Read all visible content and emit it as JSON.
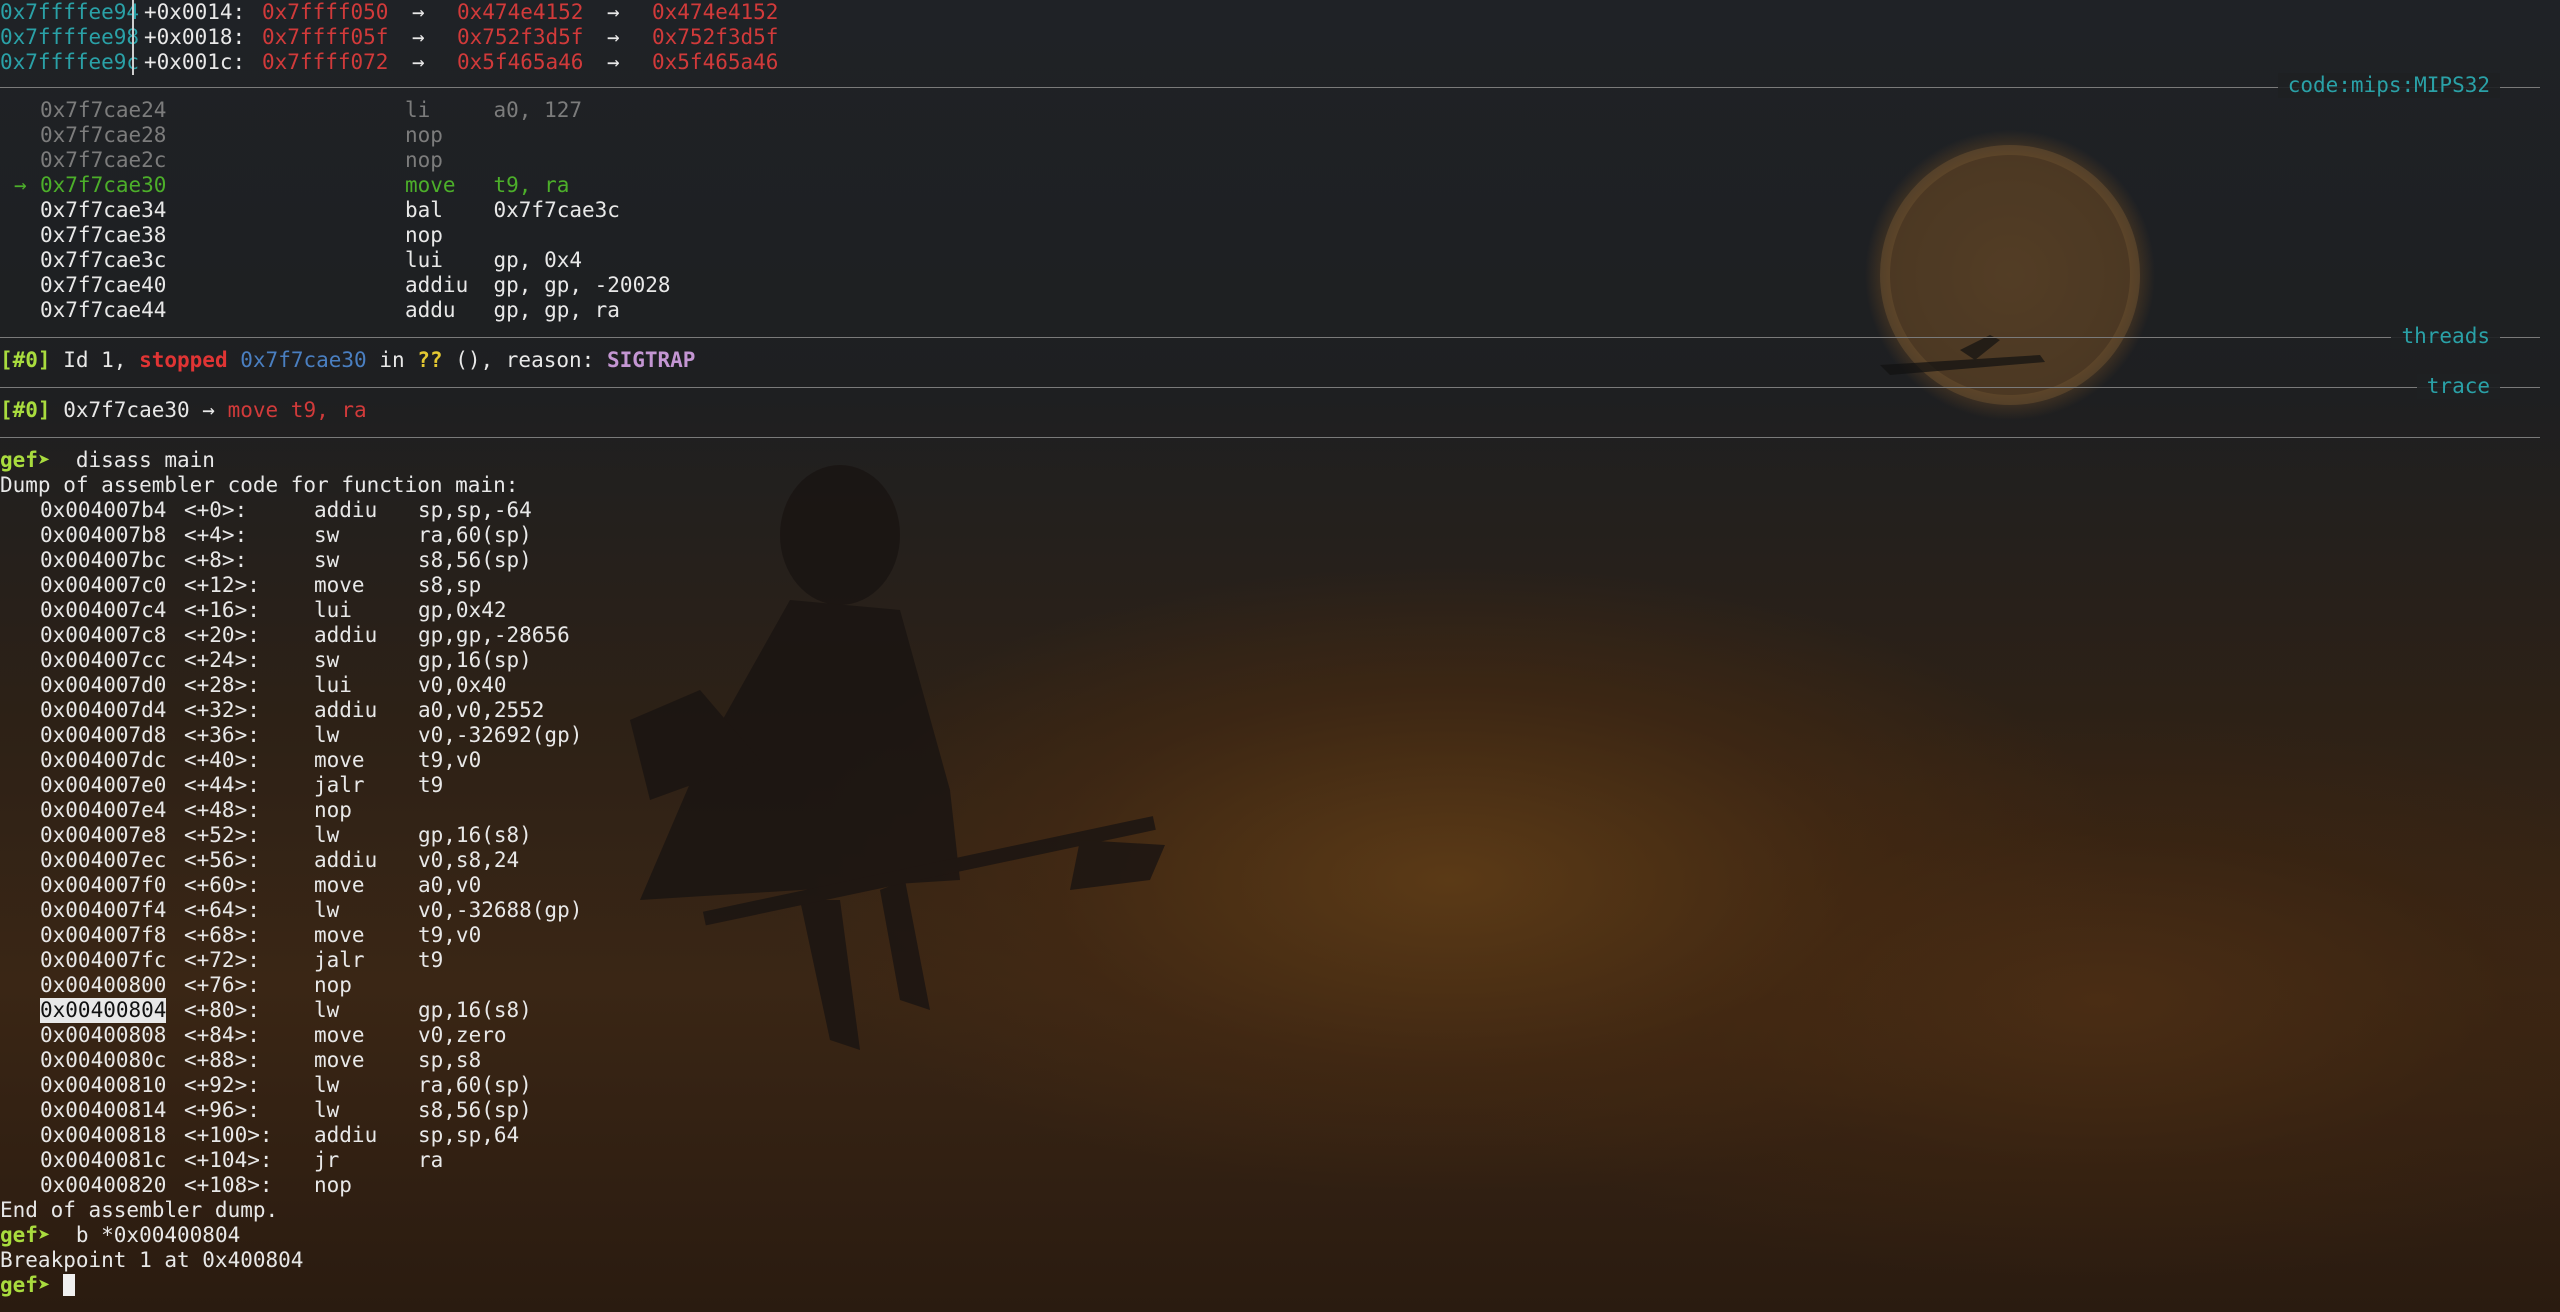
{
  "stack": [
    {
      "addr": "0x7ffffee94",
      "off": "+0x0014:",
      "v1": "0x7ffff050",
      "a1": "→",
      "v2": "0x474e4152",
      "a2": "→",
      "v3": "0x474e4152"
    },
    {
      "addr": "0x7ffffee98",
      "off": "+0x0018:",
      "v1": "0x7ffff05f",
      "a1": "→",
      "v2": "0x752f3d5f",
      "a2": "→",
      "v3": "0x752f3d5f"
    },
    {
      "addr": "0x7ffffee9c",
      "off": "+0x001c:",
      "v1": "0x7ffff072",
      "a1": "→",
      "v2": "0x5f465a46",
      "a2": "→",
      "v3": "0x5f465a46"
    }
  ],
  "sections": {
    "code_label": "code:mips:MIPS32",
    "threads_label": "threads",
    "trace_label": "trace"
  },
  "code": [
    {
      "prefix": "  ",
      "addr": "0x7f7cae24",
      "instr": "li     a0, 127",
      "state": "past"
    },
    {
      "prefix": "  ",
      "addr": "0x7f7cae28",
      "instr": "nop",
      "state": "past"
    },
    {
      "prefix": "  ",
      "addr": "0x7f7cae2c",
      "instr": "nop",
      "state": "past"
    },
    {
      "prefix": "→ ",
      "addr": "0x7f7cae30",
      "instr": "move   t9, ra",
      "state": "current"
    },
    {
      "prefix": "  ",
      "addr": "0x7f7cae34",
      "instr": "bal    0x7f7cae3c",
      "state": "next"
    },
    {
      "prefix": "  ",
      "addr": "0x7f7cae38",
      "instr": "nop",
      "state": "next"
    },
    {
      "prefix": "  ",
      "addr": "0x7f7cae3c",
      "instr": "lui    gp, 0x4",
      "state": "next"
    },
    {
      "prefix": "  ",
      "addr": "0x7f7cae40",
      "instr": "addiu  gp, gp, -20028",
      "state": "next"
    },
    {
      "prefix": "  ",
      "addr": "0x7f7cae44",
      "instr": "addu   gp, gp, ra",
      "state": "next"
    }
  ],
  "threads": {
    "idx": "[#0]",
    "text1": " Id 1, ",
    "stopped": "stopped",
    "sp1": " ",
    "addr": "0x7f7cae30",
    "in": " in ",
    "qq": "??",
    "text2": " (), reason: ",
    "reason": "SIGTRAP"
  },
  "trace": {
    "idx": "[#0]",
    "addr_arrow": " 0x7f7cae30 → ",
    "instr": "move t9, ra"
  },
  "session": {
    "prompt": "gef➤",
    "cmd1": "  disass main",
    "dump_header": "Dump of assembler code for function main:",
    "dump_footer": "End of assembler dump.",
    "cmd2": "  b *0x00400804",
    "bp_msg": "Breakpoint 1 at 0x400804"
  },
  "disasm": [
    {
      "addr": "0x004007b4",
      "off": "<+0>:",
      "op": "addiu",
      "args": "sp,sp,-64"
    },
    {
      "addr": "0x004007b8",
      "off": "<+4>:",
      "op": "sw",
      "args": "ra,60(sp)"
    },
    {
      "addr": "0x004007bc",
      "off": "<+8>:",
      "op": "sw",
      "args": "s8,56(sp)"
    },
    {
      "addr": "0x004007c0",
      "off": "<+12>:",
      "op": "move",
      "args": "s8,sp"
    },
    {
      "addr": "0x004007c4",
      "off": "<+16>:",
      "op": "lui",
      "args": "gp,0x42"
    },
    {
      "addr": "0x004007c8",
      "off": "<+20>:",
      "op": "addiu",
      "args": "gp,gp,-28656"
    },
    {
      "addr": "0x004007cc",
      "off": "<+24>:",
      "op": "sw",
      "args": "gp,16(sp)"
    },
    {
      "addr": "0x004007d0",
      "off": "<+28>:",
      "op": "lui",
      "args": "v0,0x40"
    },
    {
      "addr": "0x004007d4",
      "off": "<+32>:",
      "op": "addiu",
      "args": "a0,v0,2552"
    },
    {
      "addr": "0x004007d8",
      "off": "<+36>:",
      "op": "lw",
      "args": "v0,-32692(gp)"
    },
    {
      "addr": "0x004007dc",
      "off": "<+40>:",
      "op": "move",
      "args": "t9,v0"
    },
    {
      "addr": "0x004007e0",
      "off": "<+44>:",
      "op": "jalr",
      "args": "t9"
    },
    {
      "addr": "0x004007e4",
      "off": "<+48>:",
      "op": "nop",
      "args": ""
    },
    {
      "addr": "0x004007e8",
      "off": "<+52>:",
      "op": "lw",
      "args": "gp,16(s8)"
    },
    {
      "addr": "0x004007ec",
      "off": "<+56>:",
      "op": "addiu",
      "args": "v0,s8,24"
    },
    {
      "addr": "0x004007f0",
      "off": "<+60>:",
      "op": "move",
      "args": "a0,v0"
    },
    {
      "addr": "0x004007f4",
      "off": "<+64>:",
      "op": "lw",
      "args": "v0,-32688(gp)"
    },
    {
      "addr": "0x004007f8",
      "off": "<+68>:",
      "op": "move",
      "args": "t9,v0"
    },
    {
      "addr": "0x004007fc",
      "off": "<+72>:",
      "op": "jalr",
      "args": "t9"
    },
    {
      "addr": "0x00400800",
      "off": "<+76>:",
      "op": "nop",
      "args": ""
    },
    {
      "addr": "0x00400804",
      "off": "<+80>:",
      "op": "lw",
      "args": "gp,16(s8)",
      "selected": true
    },
    {
      "addr": "0x00400808",
      "off": "<+84>:",
      "op": "move",
      "args": "v0,zero"
    },
    {
      "addr": "0x0040080c",
      "off": "<+88>:",
      "op": "move",
      "args": "sp,s8"
    },
    {
      "addr": "0x00400810",
      "off": "<+92>:",
      "op": "lw",
      "args": "ra,60(sp)"
    },
    {
      "addr": "0x00400814",
      "off": "<+96>:",
      "op": "lw",
      "args": "s8,56(sp)"
    },
    {
      "addr": "0x00400818",
      "off": "<+100>:",
      "op": "addiu",
      "args": "sp,sp,64"
    },
    {
      "addr": "0x0040081c",
      "off": "<+104>:",
      "op": "jr",
      "args": "ra"
    },
    {
      "addr": "0x00400820",
      "off": "<+108>:",
      "op": "nop",
      "args": ""
    }
  ],
  "colors": {
    "cyan": "#2aa1a7",
    "red": "#d13a3a",
    "green_current": "#4caf2a",
    "prompt_green": "#a9dc3e",
    "reason_purple": "#c496d3"
  }
}
